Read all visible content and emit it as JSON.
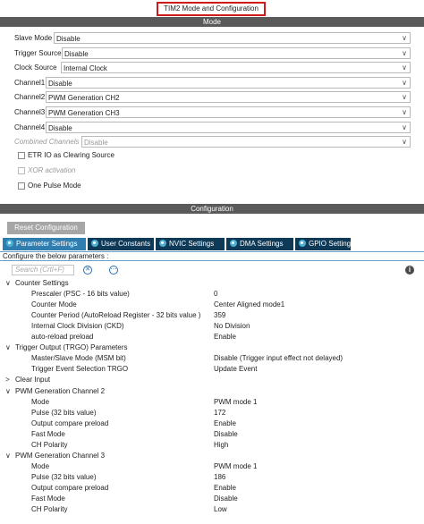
{
  "window": {
    "title": "TIM2 Mode and Configuration"
  },
  "mode": {
    "header": "Mode",
    "fields": [
      {
        "label": "Slave Mode",
        "value": "Disable",
        "disabled": false
      },
      {
        "label": "Trigger Source",
        "value": "Disable",
        "disabled": false
      },
      {
        "label": "Clock Source",
        "value": "Internal Clock",
        "disabled": false
      },
      {
        "label": "Channel1",
        "value": "Disable",
        "disabled": false
      },
      {
        "label": "Channel2",
        "value": "PWM Generation CH2",
        "disabled": false
      },
      {
        "label": "Channel3",
        "value": "PWM Generation CH3",
        "disabled": false
      },
      {
        "label": "Channel4",
        "value": "Disable",
        "disabled": false
      },
      {
        "label": "Combined Channels",
        "value": "Disable",
        "disabled": true
      }
    ],
    "checkboxes": [
      {
        "label": "ETR IO as Clearing Source",
        "checked": false,
        "disabled": false
      },
      {
        "label": "XOR activation",
        "checked": false,
        "disabled": true
      },
      {
        "label": "One Pulse Mode",
        "checked": false,
        "disabled": false
      }
    ]
  },
  "configuration": {
    "header": "Configuration",
    "reset_label": "Reset Configuration",
    "tabs": [
      {
        "label": "Parameter Settings",
        "active": true
      },
      {
        "label": "User Constants",
        "active": false
      },
      {
        "label": "NVIC Settings",
        "active": false
      },
      {
        "label": "DMA Settings",
        "active": false
      },
      {
        "label": "GPIO Settings",
        "active": false
      }
    ],
    "hint": "Configure the below parameters :",
    "search_placeholder": "Search (Crtl+F)",
    "tree": [
      {
        "kind": "group",
        "caret": "∨",
        "label": "Counter Settings"
      },
      {
        "kind": "item",
        "key": "Prescaler (PSC - 16 bits value)",
        "value": "0"
      },
      {
        "kind": "item",
        "key": "Counter Mode",
        "value": "Center Aligned mode1"
      },
      {
        "kind": "item",
        "key": "Counter Period (AutoReload Register - 32 bits value )",
        "value": "359"
      },
      {
        "kind": "item",
        "key": "Internal Clock Division (CKD)",
        "value": "No Division"
      },
      {
        "kind": "item",
        "key": "auto-reload preload",
        "value": "Enable"
      },
      {
        "kind": "group",
        "caret": "∨",
        "label": "Trigger Output (TRGO) Parameters"
      },
      {
        "kind": "item",
        "key": "Master/Slave Mode (MSM bit)",
        "value": "Disable (Trigger input effect not delayed)"
      },
      {
        "kind": "item",
        "key": "Trigger Event Selection TRGO",
        "value": "Update Event"
      },
      {
        "kind": "group",
        "caret": ">",
        "label": "Clear Input"
      },
      {
        "kind": "group",
        "caret": "∨",
        "label": "PWM Generation Channel 2"
      },
      {
        "kind": "item",
        "key": "Mode",
        "value": "PWM mode 1"
      },
      {
        "kind": "item",
        "key": "Pulse (32 bits value)",
        "value": "172"
      },
      {
        "kind": "item",
        "key": "Output compare preload",
        "value": "Enable"
      },
      {
        "kind": "item",
        "key": "Fast Mode",
        "value": "Disable"
      },
      {
        "kind": "item",
        "key": "CH Polarity",
        "value": "High"
      },
      {
        "kind": "group",
        "caret": "∨",
        "label": "PWM Generation Channel 3"
      },
      {
        "kind": "item",
        "key": "Mode",
        "value": "PWM mode 1"
      },
      {
        "kind": "item",
        "key": "Pulse (32 bits value)",
        "value": "186"
      },
      {
        "kind": "item",
        "key": "Output compare preload",
        "value": "Enable"
      },
      {
        "kind": "item",
        "key": "Fast Mode",
        "value": "Disable"
      },
      {
        "kind": "item",
        "key": "CH Polarity",
        "value": "Low"
      }
    ]
  },
  "colors": {
    "title_border": "#d0191b",
    "tab_active": "#2f7eaf",
    "tab_inactive": "#0e3a57",
    "section_bar": "#5a5a5a"
  }
}
